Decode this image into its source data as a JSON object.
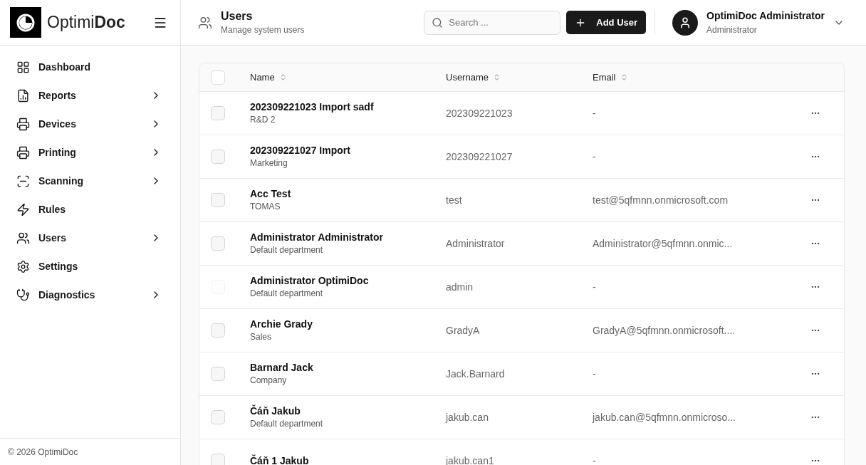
{
  "brand": {
    "name": "Optimi**Doc**"
  },
  "sidebar": {
    "items": [
      {
        "label": "Dashboard",
        "has_submenu": false
      },
      {
        "label": "Reports",
        "has_submenu": true
      },
      {
        "label": "Devices",
        "has_submenu": true
      },
      {
        "label": "Printing",
        "has_submenu": true
      },
      {
        "label": "Scanning",
        "has_submenu": true
      },
      {
        "label": "Rules",
        "has_submenu": false
      },
      {
        "label": "Users",
        "has_submenu": true
      },
      {
        "label": "Settings",
        "has_submenu": false
      },
      {
        "label": "Diagnostics",
        "has_submenu": true
      }
    ],
    "footer": "© 2026 OptimiDoc"
  },
  "header": {
    "title": "Users",
    "subtitle": "Manage system users",
    "search": {
      "placeholder": "Search ..."
    },
    "add_button": "Add User",
    "user": {
      "name": "OptimiDoc Administrator",
      "role": "Administrator"
    }
  },
  "table": {
    "select_all": {
      "checked": false
    },
    "columns": [
      "Name",
      "Username",
      "Email"
    ],
    "rows": [
      {
        "name": "202309221023 Import sadf",
        "department": "R&D 2",
        "username": "202309221023",
        "email": "-",
        "disabled": false
      },
      {
        "name": "202309221027 Import",
        "department": "Marketing",
        "username": "202309221027",
        "email": "-",
        "disabled": false
      },
      {
        "name": "Acc Test",
        "department": "TOMAS",
        "username": "test",
        "email": "test@5qfmnn.onmicrosoft.com",
        "disabled": false
      },
      {
        "name": "Administrator Administrator",
        "department": "Default department",
        "username": "Administrator",
        "email": "Administrator@5qfmnn.onmic...",
        "disabled": false
      },
      {
        "name": "Administrator OptimiDoc",
        "department": "Default department",
        "username": "admin",
        "email": "-",
        "disabled": true
      },
      {
        "name": "Archie Grady",
        "department": "Sales",
        "username": "GradyA",
        "email": "GradyA@5qfmnn.onmicrosoft....",
        "disabled": false
      },
      {
        "name": "Barnard Jack",
        "department": "Company",
        "username": "Jack.Barnard",
        "email": "-",
        "disabled": false
      },
      {
        "name": "Čáň Jakub",
        "department": "Default department",
        "username": "jakub.can",
        "email": "jakub.can@5qfmnn.onmicroso...",
        "disabled": false
      },
      {
        "name": "Čáň 1 Jakub",
        "username": "jakub.can1",
        "email": "-",
        "disabled": false
      }
    ]
  }
}
